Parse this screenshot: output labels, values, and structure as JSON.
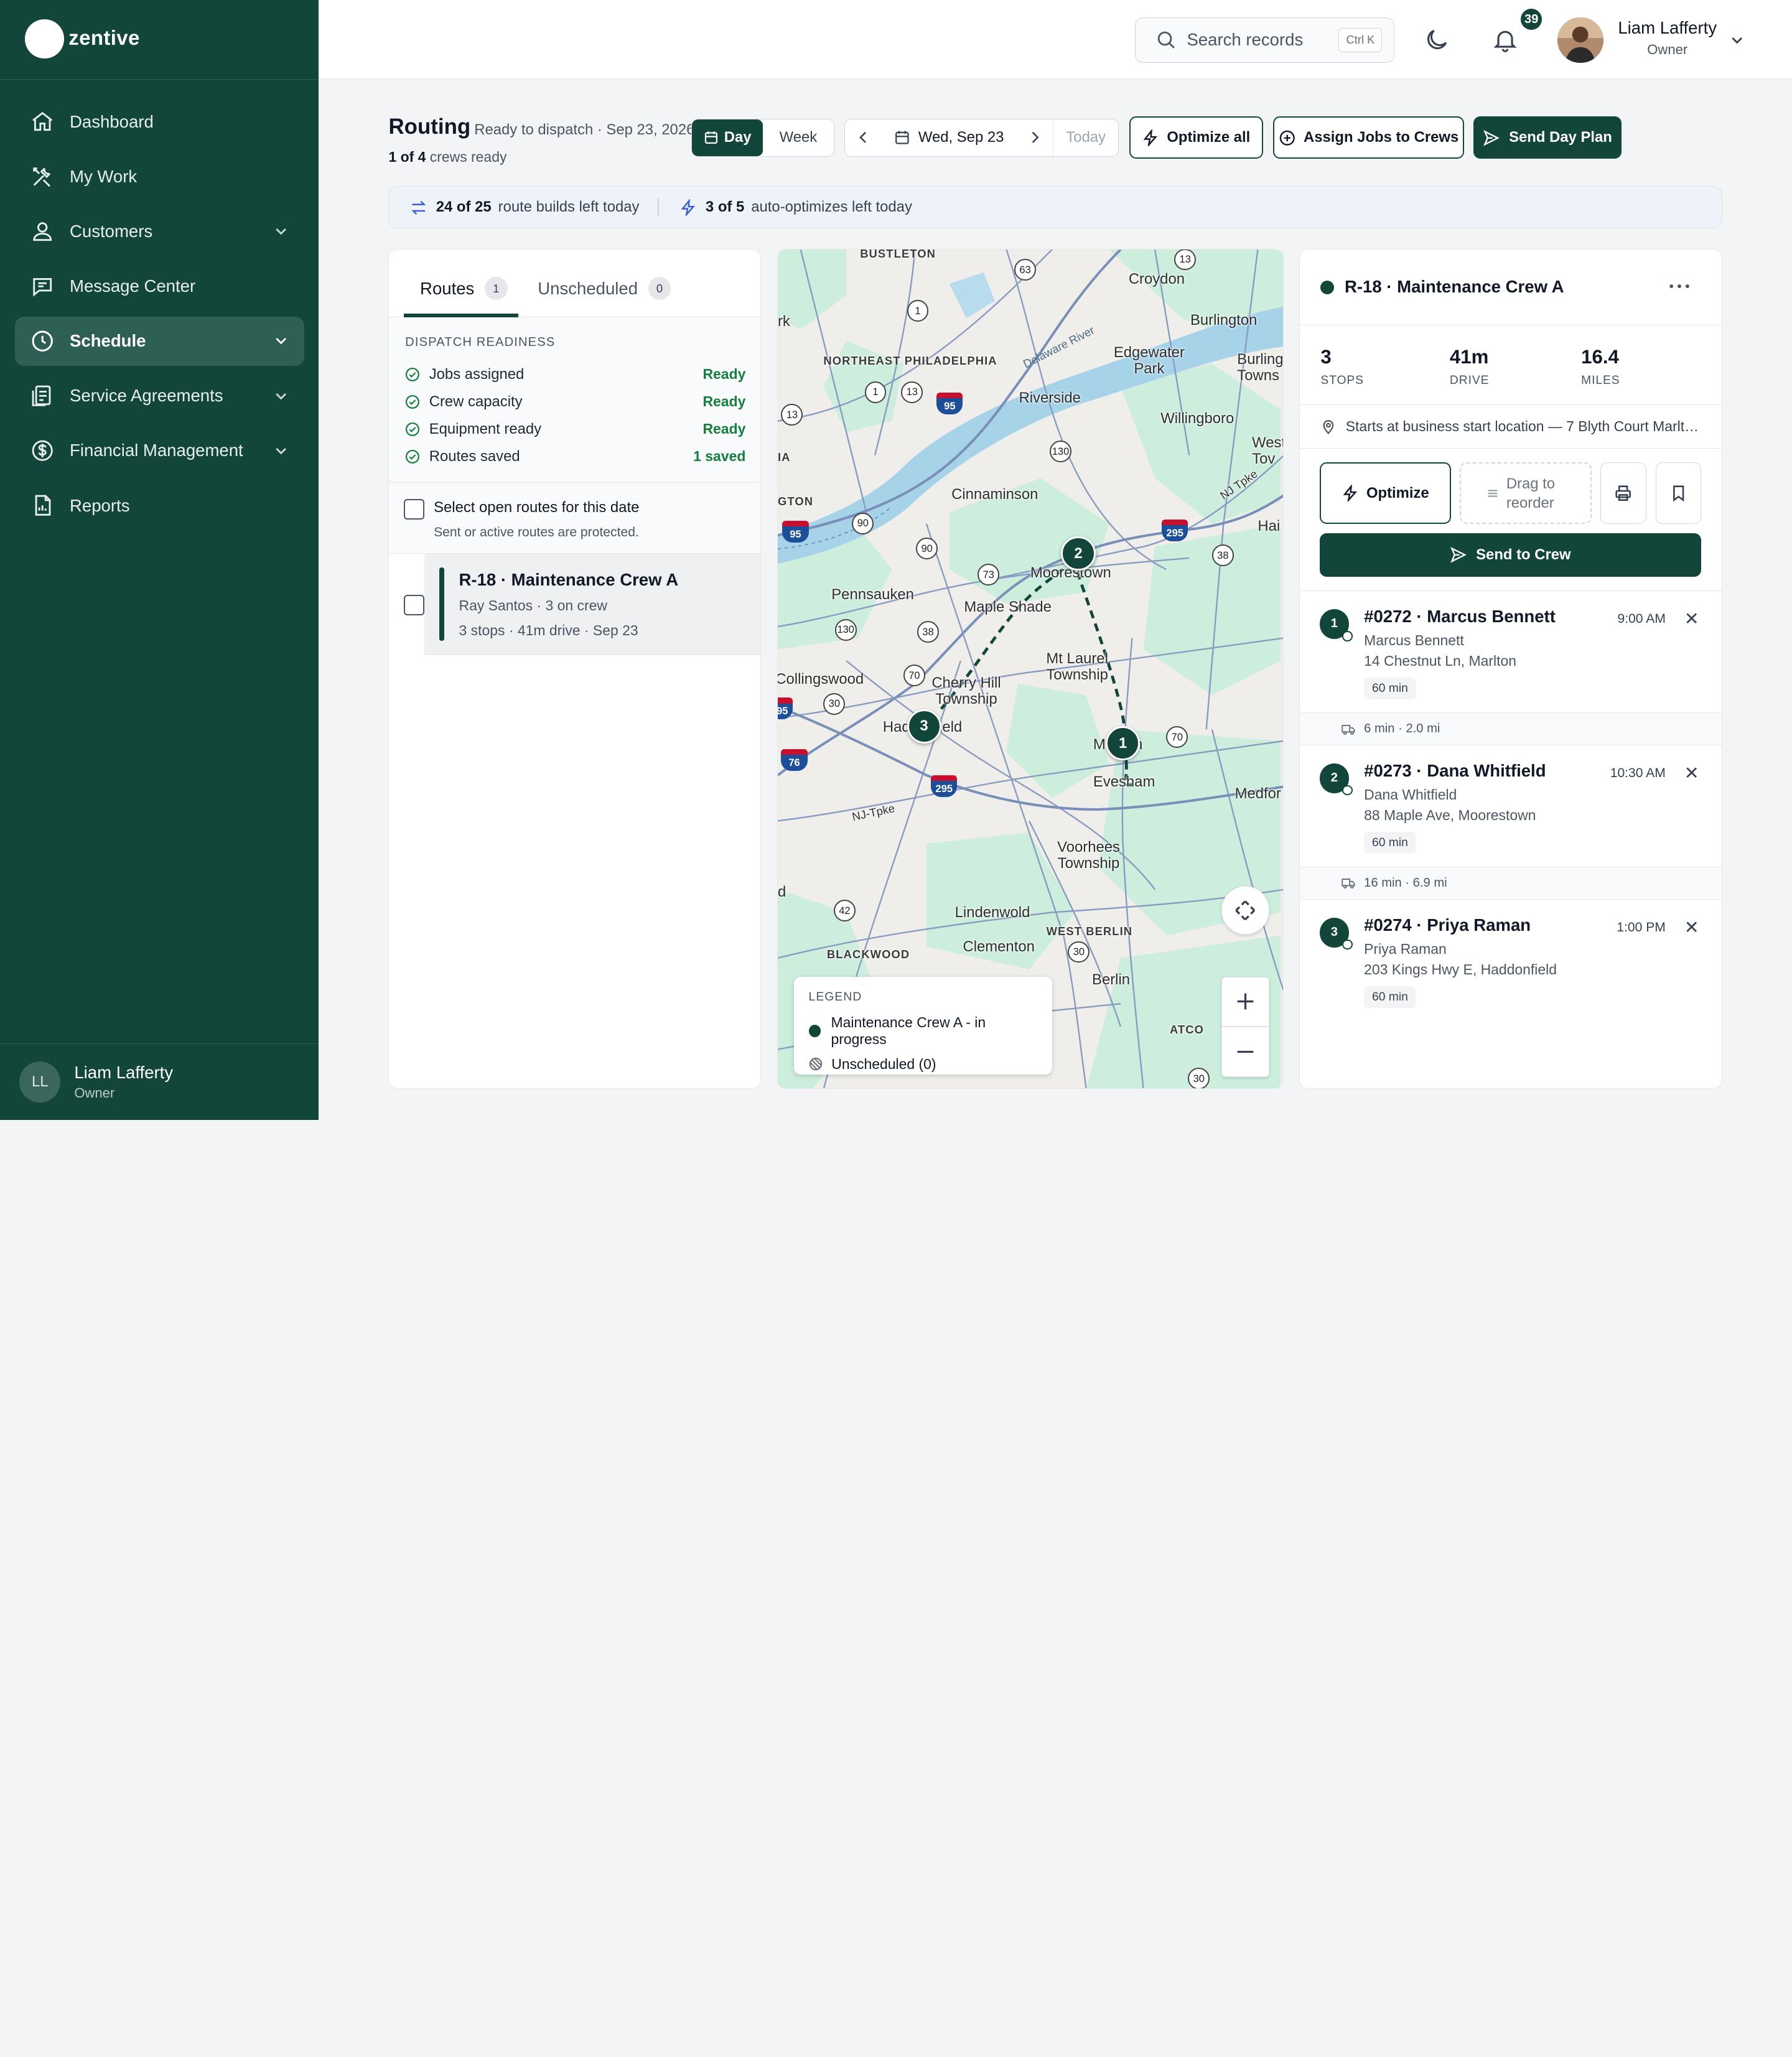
{
  "app": {
    "brand": "zentive"
  },
  "sidebar": {
    "items": [
      {
        "label": "Dashboard",
        "icon": "home-icon"
      },
      {
        "label": "My Work",
        "icon": "tools-icon"
      },
      {
        "label": "Customers",
        "icon": "users-icon"
      },
      {
        "label": "Message Center",
        "icon": "chat-icon"
      },
      {
        "label": "Schedule",
        "icon": "clock-icon"
      },
      {
        "label": "Service Agreements",
        "icon": "agreement-icon"
      },
      {
        "label": "Financial Management",
        "icon": "dollar-icon"
      },
      {
        "label": "Reports",
        "icon": "report-icon"
      }
    ],
    "user": {
      "initials": "LL",
      "name": "Liam Lafferty",
      "role": "Owner"
    }
  },
  "topbar": {
    "search_placeholder": "Search records",
    "shortcut": "Ctrl K",
    "notifications": "39",
    "user_name": "Liam Lafferty",
    "user_role": "Owner"
  },
  "header": {
    "title": "Routing",
    "subtitle": "Ready to dispatch · Sep 23, 2026",
    "crews_ready_count": "1 of 4",
    "crews_ready_label": "crews ready",
    "view_day": "Day",
    "view_week": "Week",
    "date": "Wed, Sep 23",
    "today": "Today",
    "optimize_all": "Optimize all",
    "assign_jobs": "Assign Jobs to Crews",
    "send_day_plan": "Send Day Plan"
  },
  "quota": {
    "builds_count": "24 of 25",
    "builds_label": "route builds left today",
    "auto_count": "3 of 5",
    "auto_label": "auto-optimizes left today"
  },
  "routes_panel": {
    "tab_routes": "Routes",
    "tab_routes_count": "1",
    "tab_unscheduled": "Unscheduled",
    "tab_unscheduled_count": "0",
    "readiness_title": "DISPATCH READINESS",
    "readiness": [
      {
        "label": "Jobs assigned",
        "status": "Ready"
      },
      {
        "label": "Crew capacity",
        "status": "Ready"
      },
      {
        "label": "Equipment ready",
        "status": "Ready"
      },
      {
        "label": "Routes saved",
        "status": "1 saved"
      }
    ],
    "select_open_label": "Select open routes for this date",
    "select_open_sub": "Sent or active routes are protected.",
    "route": {
      "name": "R-18 · Maintenance Crew A",
      "crew": "Ray Santos · 3 on crew",
      "summary": "3 stops · 41m drive · Sep 23"
    }
  },
  "map": {
    "places": [
      "BUSTLETON",
      "Croydon",
      "NORTHEAST PHILADELPHIA",
      "Burlington",
      "Edgewater Park",
      "Burling Towns",
      "Riverside",
      "Willingboro",
      "West Tov",
      "Cinnaminson",
      "Hai",
      "Moorestown",
      "Pennsauken",
      "Maple Shade",
      "Mt Laurel Township",
      "Collingswood",
      "Cherry Hill Township",
      "Haddonfield",
      "Marlton",
      "Evesham",
      "Medfor",
      "Voorhees Township",
      "Lindenwold",
      "WEST BERLIN",
      "BLACKWOOD",
      "Clementon",
      "Berlin",
      "ATCO",
      "Delaware River",
      "NJ Tpke",
      "NJ-Tpke",
      "rk",
      "IA",
      "GTON",
      "d"
    ],
    "shields": [
      "63",
      "1",
      "13",
      "13",
      "1",
      "13",
      "130",
      "90",
      "90",
      "73",
      "38",
      "38",
      "130",
      "70",
      "30",
      "42",
      "30",
      "70",
      "30"
    ],
    "interstates": [
      "95",
      "95",
      "295",
      "295",
      "76",
      "295"
    ],
    "stop_markers": [
      "1",
      "2",
      "3"
    ],
    "legend_title": "LEGEND",
    "legend_route": "Maintenance Crew A - in progress",
    "legend_unscheduled": "Unscheduled (0)"
  },
  "route_detail": {
    "title": "R-18 · Maintenance Crew A",
    "stats": [
      {
        "value": "3",
        "label": "STOPS"
      },
      {
        "value": "41m",
        "label": "DRIVE"
      },
      {
        "value": "16.4",
        "label": "MILES"
      }
    ],
    "start_location": "Starts at business start location — 7 Blyth Court Marlton",
    "optimize": "Optimize",
    "drag_to_reorder": "Drag to reorder",
    "send_to_crew": "Send to Crew",
    "stops": [
      {
        "num": "1",
        "name": "#0272 · Marcus Bennett",
        "time": "9:00 AM",
        "customer": "Marcus Bennett",
        "address": "14 Chestnut Ln, Marlton",
        "duration": "60 min"
      },
      {
        "num": "2",
        "name": "#0273 · Dana Whitfield",
        "time": "10:30 AM",
        "customer": "Dana Whitfield",
        "address": "88 Maple Ave, Moorestown",
        "duration": "60 min"
      },
      {
        "num": "3",
        "name": "#0274 · Priya Raman",
        "time": "1:00 PM",
        "customer": "Priya Raman",
        "address": "203 Kings Hwy E, Haddonfield",
        "duration": "60 min"
      }
    ],
    "drives": [
      "6 min · 2.0 mi",
      "16 min · 6.9 mi"
    ]
  },
  "colors": {
    "brand": "#12463b",
    "ready": "#15803d",
    "water": "#a7d3e9",
    "park": "#cdeedd"
  }
}
